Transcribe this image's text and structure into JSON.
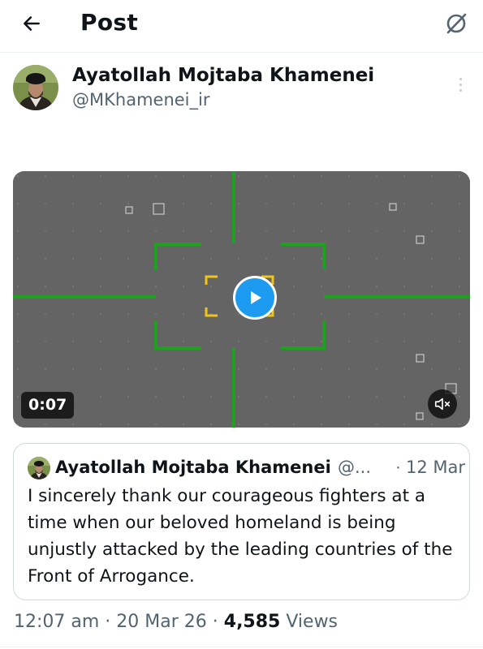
{
  "header": {
    "title": "Post",
    "back_icon": "arrow-left-icon",
    "grok_icon": "grok-icon"
  },
  "post": {
    "author_name": "Ayatollah Mojtaba Khamenei",
    "author_handle": "@MKhamenei_ir",
    "more_icon": "more-vertical-icon",
    "video": {
      "duration": "0:07",
      "play_icon": "play-icon",
      "mute_icon": "speaker-muted-icon",
      "reticle_color": "#1ea11e",
      "target_box_color": "#f0c419"
    },
    "quote": {
      "author_name": "Ayatollah Mojtaba Khamenei",
      "author_handle": "@...",
      "separator": "·",
      "date": "12 Mar",
      "text": "I sincerely thank our courageous fighters at a time when our beloved homeland is being unjustly attacked by the leading countries of the Front of Arrogance."
    },
    "meta": {
      "time": "12:07 am",
      "sep1": " · ",
      "date": "20 Mar 26",
      "sep2": " · ",
      "views_count": "4,585",
      "views_label": " Views"
    }
  },
  "colors": {
    "accent": "#1d9bf0",
    "secondary_text": "#536471",
    "border": "#cfd9de"
  }
}
